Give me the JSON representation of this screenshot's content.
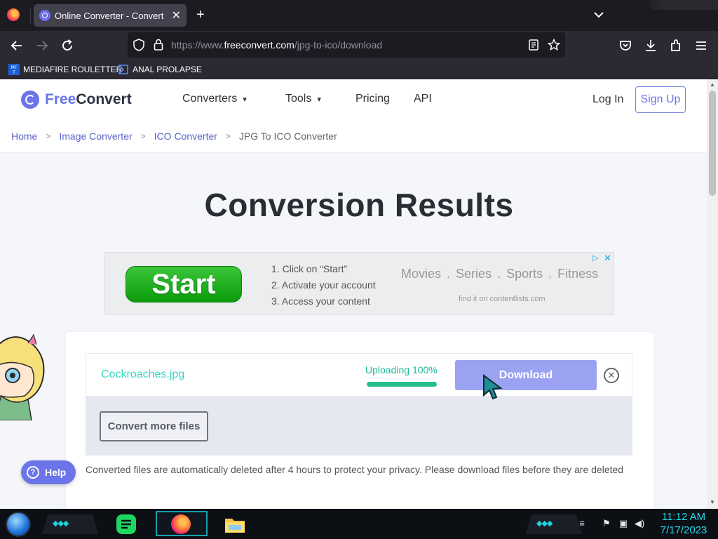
{
  "browser": {
    "tab_title": "Online Converter - Convert Ima",
    "url_prefix": "https://www.",
    "url_domain": "freeconvert.com",
    "url_path": "/jpg-to-ico/download",
    "bookmarks": [
      {
        "label": "MEDIAFIRE ROULETTER"
      },
      {
        "label": "ANAL PROLAPSE"
      }
    ]
  },
  "site": {
    "logo_free": "Free",
    "logo_convert": "Convert",
    "menu": [
      {
        "label": "Converters"
      },
      {
        "label": "Tools"
      },
      {
        "label": "Pricing"
      },
      {
        "label": "API"
      }
    ],
    "login_label": "Log In",
    "signup_label": "Sign Up",
    "breadcrumb": [
      {
        "label": "Home"
      },
      {
        "label": "Image Converter"
      },
      {
        "label": "ICO Converter"
      },
      {
        "label": "JPG To ICO Converter"
      }
    ]
  },
  "main": {
    "title": "Conversion Results",
    "ad": {
      "start_label": "Start",
      "steps": [
        "1. Click on “Start”",
        "2. Activate your account",
        "3. Access your content"
      ],
      "categories": [
        "Movies",
        "Series",
        "Sports",
        "Fitness"
      ],
      "cat_separator": ".",
      "footer": "find it on contentlists.com"
    },
    "file": {
      "name": "Cockroaches.jpg",
      "status": "Uploading 100%",
      "progress": 1.0,
      "download_label": "Download",
      "remove_symbol": "✕"
    },
    "convert_more_label": "Convert more files",
    "privacy_note": "Converted files are automatically deleted after 4 hours to protect your privacy. Please download files before they are deleted",
    "help_label": "Help"
  },
  "taskbar": {
    "time": "11:12 AM",
    "date": "7/17/2023"
  },
  "colors": {
    "brand": "#6b74e8",
    "download_button": "#9ba2f2",
    "file_name": "#33d6c4",
    "progress": "#22c08a",
    "clock": "#26d9e8"
  }
}
